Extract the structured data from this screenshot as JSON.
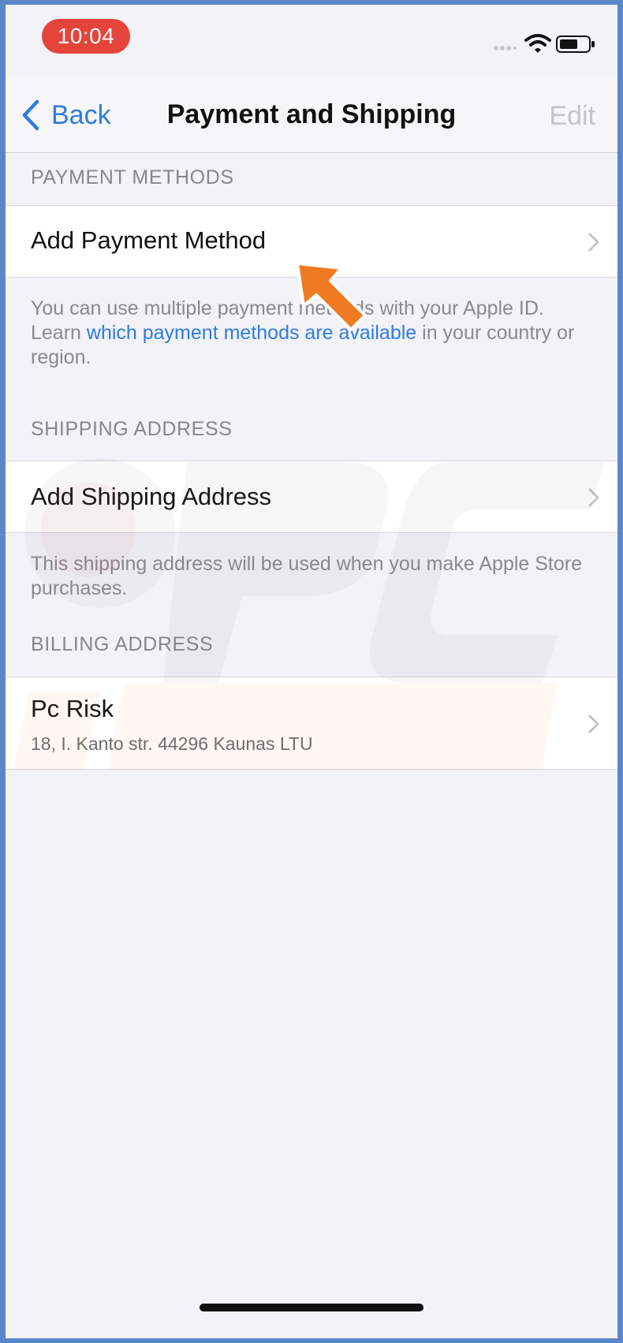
{
  "status_bar": {
    "time": "10:04",
    "icons": [
      "cellular-signal-icon",
      "wifi-icon",
      "battery-icon"
    ]
  },
  "nav": {
    "back_label": "Back",
    "title": "Payment and Shipping",
    "edit_label": "Edit"
  },
  "payment": {
    "header": "PAYMENT METHODS",
    "add_label": "Add Payment Method",
    "footer_pre": "You can use multiple payment methods with your Apple ID. Learn ",
    "footer_link": "which payment methods are available",
    "footer_post": " in your country or region."
  },
  "shipping": {
    "header": "SHIPPING ADDRESS",
    "add_label": "Add Shipping Address",
    "footer": "This shipping address will be used when you make Apple Store purchases."
  },
  "billing": {
    "header": "BILLING ADDRESS",
    "name": "Pc Risk",
    "address": "18, I. Kanto str. 44296 Kaunas LTU"
  },
  "colors": {
    "accent": "#2f7ce0",
    "time_pill": "#e5443a",
    "annotation_arrow": "#f07a22",
    "frame": "#5b87c9"
  }
}
